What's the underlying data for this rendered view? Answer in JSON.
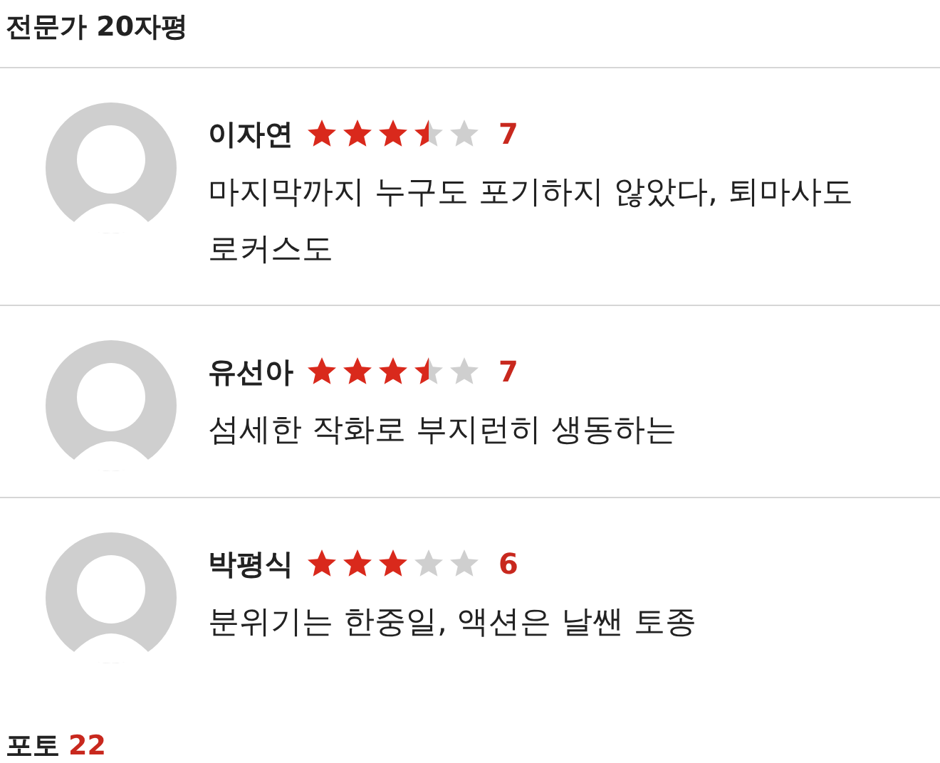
{
  "section_title": {
    "label": "전문가 20자평"
  },
  "reviews": [
    {
      "name": "이자연",
      "stars": 3.5,
      "score": "7",
      "comment": "마지막까지 누구도 포기하지 않았다, 퇴마사도 로커스도"
    },
    {
      "name": "유선아",
      "stars": 3.5,
      "score": "7",
      "comment": "섬세한 작화로 부지런히 생동하는"
    },
    {
      "name": "박평식",
      "stars": 3,
      "score": "6",
      "comment": "분위기는 한중일, 액션은 날쌘 토종"
    }
  ],
  "photos": {
    "label": "포토",
    "count": "22"
  }
}
